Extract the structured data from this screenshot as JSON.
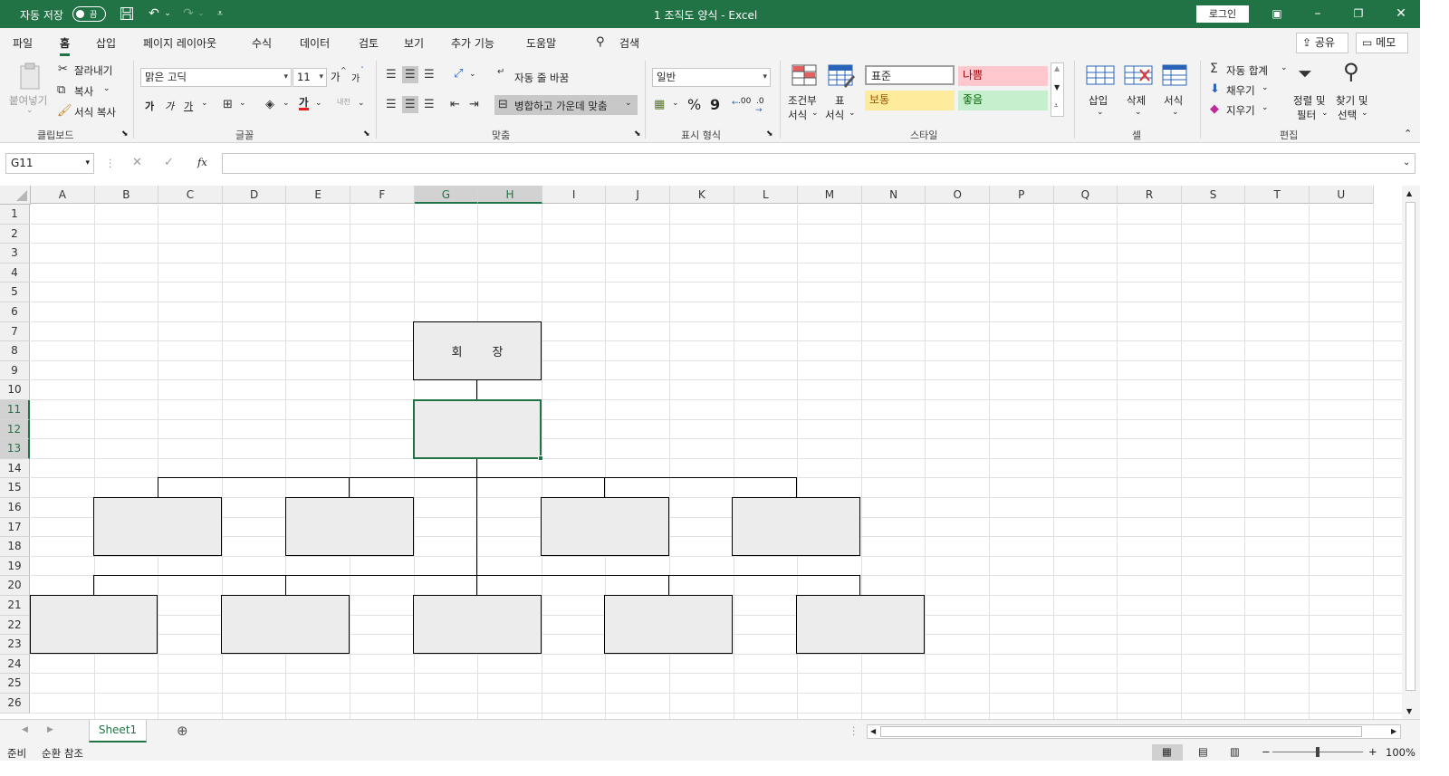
{
  "title_bar": {
    "autosave_label": "자동 저장",
    "autosave_state": "끔",
    "document_title": "1 조직도 양식  -  Excel",
    "login_button": "로그인"
  },
  "menu_tabs": [
    "파일",
    "홈",
    "삽입",
    "페이지 레이아웃",
    "수식",
    "데이터",
    "검토",
    "보기",
    "추가 기능",
    "도움말"
  ],
  "active_tab": "홈",
  "search_label": "검색",
  "share_button": "공유",
  "memo_button": "메모",
  "ribbon": {
    "clipboard": {
      "paste": "붙여넣기",
      "cut": "잘라내기",
      "copy": "복사",
      "format_painter": "서식 복사",
      "group_label": "클립보드"
    },
    "font": {
      "font_name": "맑은 고딕",
      "font_size": "11",
      "grow": "가",
      "shrink": "가",
      "bold": "가",
      "italic": "가",
      "underline": "가",
      "font_color_glyph": "가",
      "phonetic": "내천",
      "group_label": "글꼴"
    },
    "alignment": {
      "wrap_text": "자동 줄 바꿈",
      "merge_center": "병합하고 가운데 맞춤",
      "group_label": "맞춤"
    },
    "number": {
      "format": "일반",
      "percent": "%",
      "comma": "9",
      "inc_decimal": ".00",
      "dec_decimal": ".0",
      "group_label": "표시 형식"
    },
    "styles": {
      "conditional_1": "조건부",
      "conditional_2": "서식",
      "table_1": "표",
      "table_2": "서식",
      "normal": "표준",
      "bad": "나쁨",
      "neutral": "보통",
      "good": "좋음",
      "group_label": "스타일"
    },
    "cells": {
      "insert": "삽입",
      "delete": "삭제",
      "format": "서식",
      "group_label": "셀"
    },
    "editing": {
      "autosum": "자동 합계",
      "fill": "채우기",
      "clear": "지우기",
      "sort_1": "정렬 및",
      "sort_2": "필터",
      "find_1": "찾기 및",
      "find_2": "선택",
      "group_label": "편집"
    }
  },
  "formula_bar": {
    "name_box": "G11",
    "fx": "fx",
    "formula": ""
  },
  "columns": [
    "A",
    "B",
    "C",
    "D",
    "E",
    "F",
    "G",
    "H",
    "I",
    "J",
    "K",
    "L",
    "M",
    "N",
    "O",
    "P",
    "Q",
    "R",
    "S",
    "T",
    "U"
  ],
  "rows": [
    "1",
    "2",
    "3",
    "4",
    "5",
    "6",
    "7",
    "8",
    "9",
    "10",
    "11",
    "12",
    "13",
    "14",
    "15",
    "16",
    "17",
    "18",
    "19",
    "20",
    "21",
    "22",
    "23",
    "24",
    "25",
    "26"
  ],
  "org_chart": {
    "chairman": "회        장"
  },
  "sheet_tab": "Sheet1",
  "status": {
    "ready": "준비",
    "circular": "순환 참조",
    "zoom": "100%",
    "zoom_minus": "−",
    "zoom_plus": "+"
  }
}
